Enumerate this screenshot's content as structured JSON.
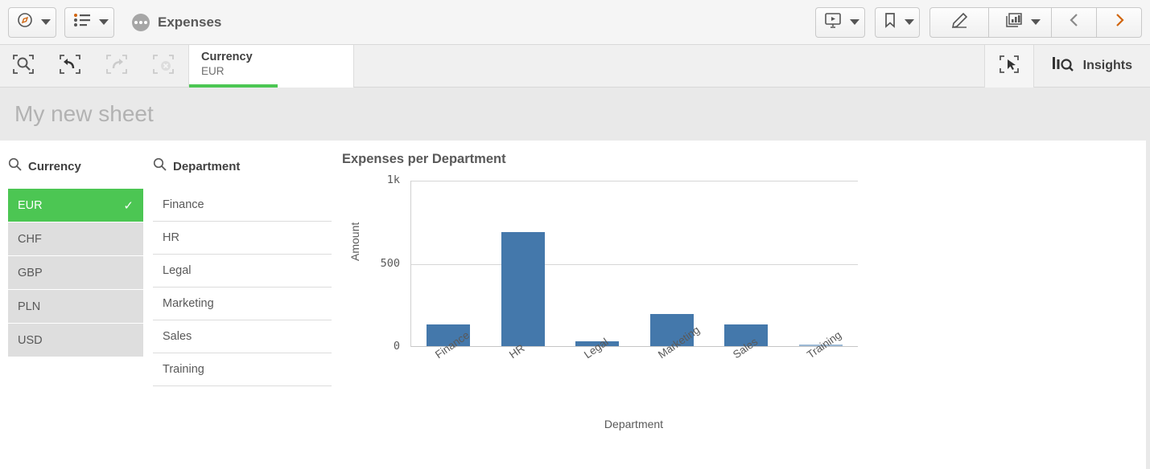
{
  "topbar": {
    "nav_button": {
      "icon": "compass-icon",
      "caret": "chevron-down-icon"
    },
    "sheets_button": {
      "icon": "sheet-list-icon",
      "caret": "chevron-down-icon"
    },
    "app": {
      "icon": "app-menu-dots-icon",
      "title": "Expenses"
    },
    "right_buttons": [
      {
        "name": "storytelling-button",
        "icon": "presentation-icon"
      },
      {
        "name": "bookmarks-button",
        "icon": "bookmark-icon"
      },
      {
        "name": "edit-sheet-button",
        "icon": "pencil-icon"
      },
      {
        "name": "charts-button",
        "icon": "bar-chart-icon"
      },
      {
        "name": "previous-sheet-button",
        "icon": "chevron-left-icon"
      },
      {
        "name": "next-sheet-button",
        "icon": "chevron-right-icon"
      }
    ]
  },
  "selection_bar": {
    "tools": [
      {
        "name": "selection-search-button",
        "icon": "selection-search-icon",
        "disabled": false
      },
      {
        "name": "step-back-button",
        "icon": "step-back-icon",
        "disabled": false
      },
      {
        "name": "step-forward-button",
        "icon": "step-forward-icon",
        "disabled": true
      },
      {
        "name": "clear-all-selections-button",
        "icon": "clear-selections-icon",
        "disabled": true
      }
    ],
    "chip": {
      "field": "Currency",
      "value": "EUR"
    },
    "lasso": {
      "icon": "lasso-selection-icon"
    },
    "insights": {
      "icon": "insights-icon",
      "label": "Insights"
    }
  },
  "sheet": {
    "title": "My new sheet"
  },
  "filters": [
    {
      "id": "currency",
      "title": "Currency",
      "search_icon": "search-icon",
      "items": [
        {
          "label": "EUR",
          "selected": true,
          "check": "✓"
        },
        {
          "label": "CHF",
          "selected": false,
          "check": ""
        },
        {
          "label": "GBP",
          "selected": false,
          "check": ""
        },
        {
          "label": "PLN",
          "selected": false,
          "check": ""
        },
        {
          "label": "USD",
          "selected": false,
          "check": ""
        }
      ]
    },
    {
      "id": "department",
      "title": "Department",
      "search_icon": "search-icon",
      "items": [
        {
          "label": "Finance",
          "selected": false,
          "check": ""
        },
        {
          "label": "HR",
          "selected": false,
          "check": ""
        },
        {
          "label": "Legal",
          "selected": false,
          "check": ""
        },
        {
          "label": "Marketing",
          "selected": false,
          "check": ""
        },
        {
          "label": "Sales",
          "selected": false,
          "check": ""
        },
        {
          "label": "Training",
          "selected": false,
          "check": ""
        }
      ]
    }
  ],
  "colors": {
    "bar": "#4478ab",
    "selection_green": "#4cc653",
    "accent_orange": "#d1650f",
    "sheet_bg": "#e9e9e9"
  },
  "chart_data": {
    "type": "bar",
    "title": "Expenses per Department",
    "xlabel": "Department",
    "ylabel": "Amount",
    "categories": [
      "Finance",
      "HR",
      "Legal",
      "Marketing",
      "Sales",
      "Training"
    ],
    "values": [
      129,
      688,
      30,
      193,
      129,
      8
    ],
    "ylim": [
      0,
      1000
    ],
    "yticks": [
      0,
      500,
      1000
    ],
    "ytick_labels": [
      "0",
      "500",
      "1k"
    ],
    "grid": true,
    "legend": "none"
  }
}
